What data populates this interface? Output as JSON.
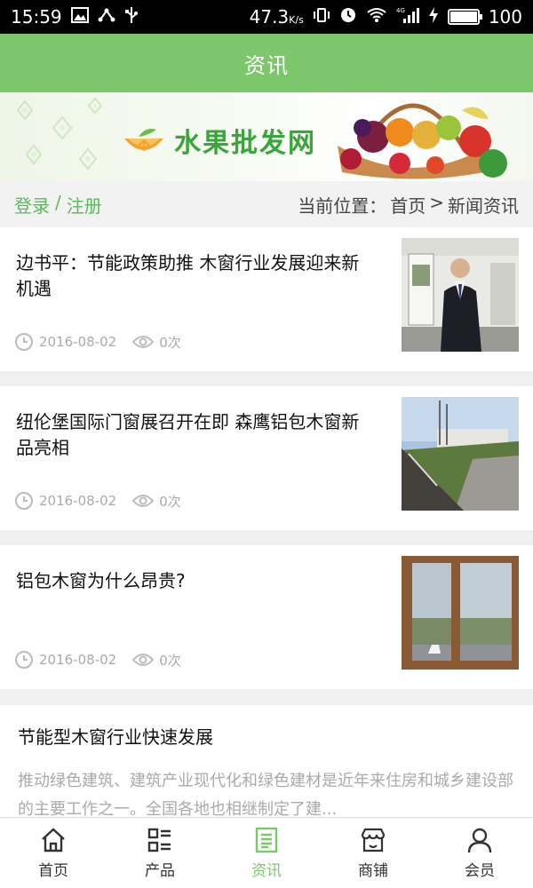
{
  "status_bar": {
    "time": "15:59",
    "speed": "47.3",
    "speed_unit": "K/s",
    "network": "4G",
    "battery": "100"
  },
  "header": {
    "title": "资讯"
  },
  "banner": {
    "title": "水果批发网"
  },
  "crumb": {
    "login": "登录",
    "separator": "/",
    "register": "注册",
    "location_label": "当前位置：",
    "home": "首页",
    "arrow": ">",
    "current": "新闻资讯"
  },
  "news": [
    {
      "title": "边书平：节能政策助推 木窗行业发展迎来新机遇",
      "date": "2016-08-02",
      "views": "0次"
    },
    {
      "title": "纽伦堡国际门窗展召开在即 森鹰铝包木窗新品亮相",
      "date": "2016-08-02",
      "views": "0次"
    },
    {
      "title": "铝包木窗为什么昂贵?",
      "date": "2016-08-02",
      "views": "0次"
    }
  ],
  "text_item": {
    "title": "节能型木窗行业快速发展",
    "body": "推动绿色建筑、建筑产业现代化和绿色建材是近年来住房和城乡建设部的主要工作之一。全国各地也相继制定了建..."
  },
  "tabs": [
    {
      "label": "首页",
      "icon": "home-icon"
    },
    {
      "label": "产品",
      "icon": "grid-icon"
    },
    {
      "label": "资讯",
      "icon": "news-icon"
    },
    {
      "label": "商铺",
      "icon": "store-icon"
    },
    {
      "label": "会员",
      "icon": "user-icon"
    }
  ],
  "colors": {
    "accent": "#7cc66c",
    "link": "#5cb85c"
  }
}
